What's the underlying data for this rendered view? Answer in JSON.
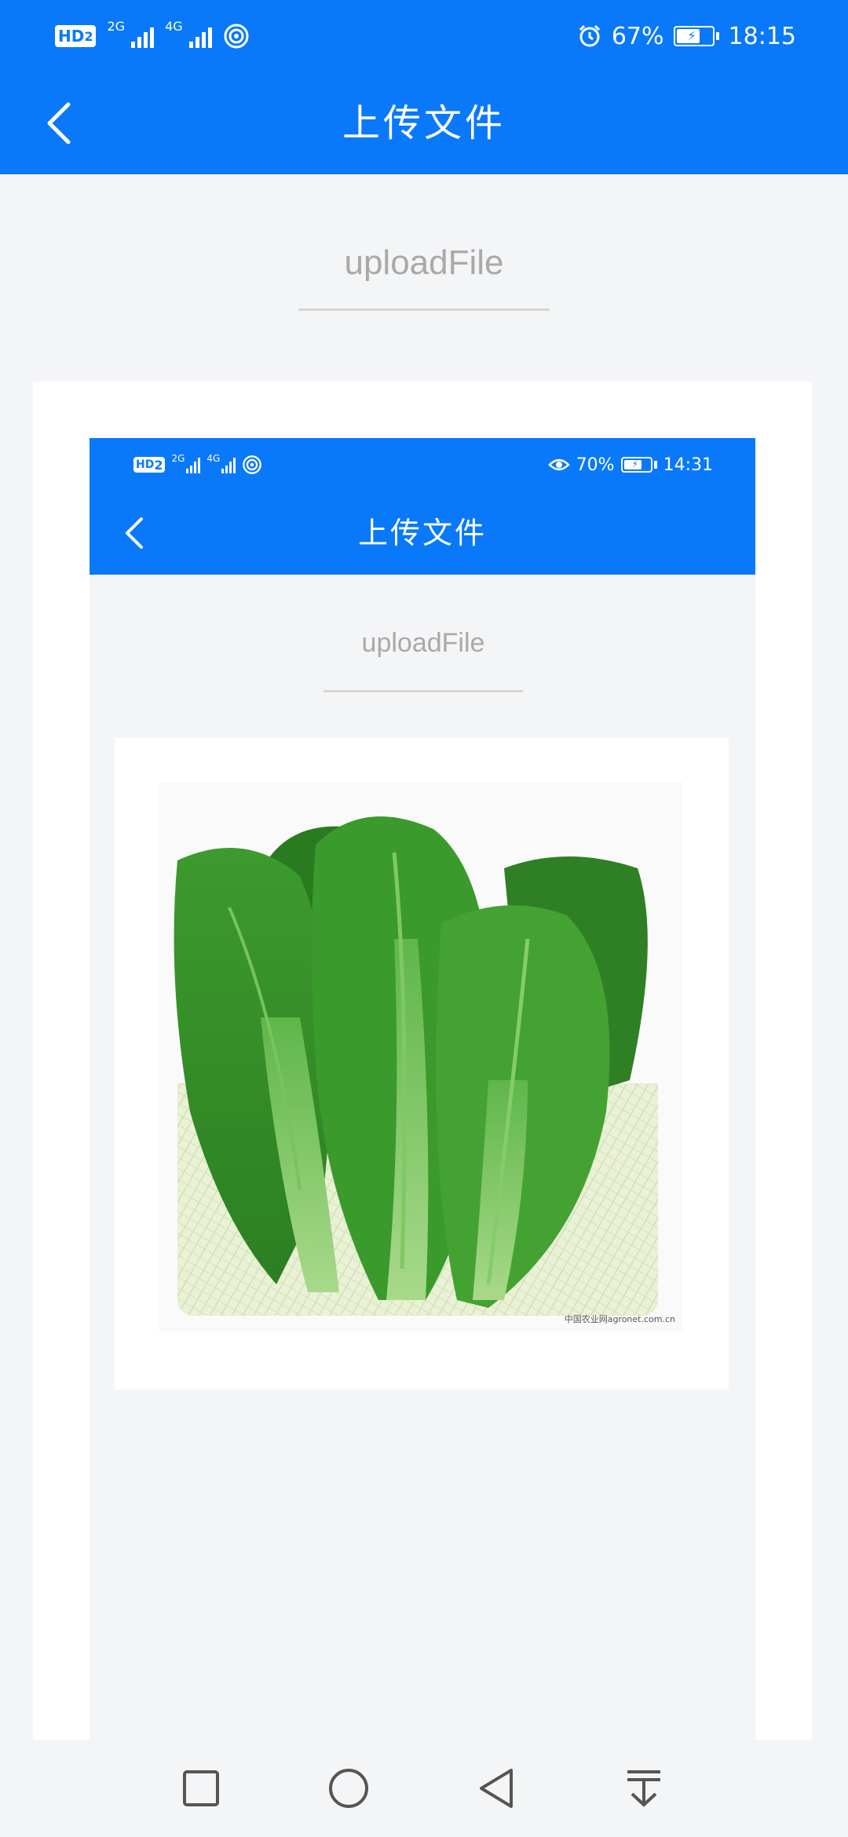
{
  "status_bar": {
    "hd_label": "HD",
    "hd_sub": "2",
    "net1_label": "2G",
    "net2_label": "4G",
    "alarm_icon": "alarm-icon",
    "battery_level": "67%",
    "time": "18:15"
  },
  "header": {
    "title": "上传文件",
    "back_icon": "chevron-left-icon"
  },
  "upload_field": {
    "value": "uploadFile"
  },
  "preview": {
    "status_bar": {
      "hd_label": "HD",
      "hd_sub": "2",
      "net1_label": "2G",
      "net2_label": "4G",
      "eye_icon": "eye-icon",
      "battery_level": "70%",
      "time": "14:31"
    },
    "header": {
      "title": "上传文件"
    },
    "upload_field": {
      "value": "uploadFile"
    },
    "image": {
      "description_icon": "bok-choy-photo",
      "watermark": "中国农业网agronet.com.cn"
    }
  },
  "nav_bar": {
    "recents_icon": "square-icon",
    "home_icon": "circle-icon",
    "back_icon": "triangle-back-icon",
    "notifications_icon": "pull-down-icon"
  },
  "colors": {
    "primary": "#0979fa",
    "background": "#f4f5f7",
    "placeholder_text": "#a9a9a9"
  }
}
